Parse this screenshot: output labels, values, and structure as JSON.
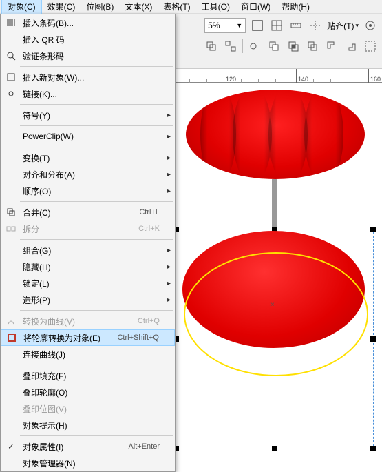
{
  "menubar": {
    "items": [
      {
        "label": "对象(C)"
      },
      {
        "label": "效果(C)"
      },
      {
        "label": "位图(B)"
      },
      {
        "label": "文本(X)"
      },
      {
        "label": "表格(T)"
      },
      {
        "label": "工具(O)"
      },
      {
        "label": "窗口(W)"
      },
      {
        "label": "帮助(H)"
      }
    ]
  },
  "toolbar": {
    "zoom_value": "5%",
    "align_label": "贴齐(T)"
  },
  "ruler": {
    "ticks": [
      "120",
      "140",
      "160"
    ]
  },
  "menu": {
    "insert_barcode": "插入条码(B)...",
    "insert_qr": "插入 QR 码",
    "verify_barcode": "验证条形码",
    "insert_new_obj": "插入新对象(W)...",
    "links": "链接(K)...",
    "symbols": "符号(Y)",
    "powerclip": "PowerClip(W)",
    "transform": "变换(T)",
    "align_dist": "对齐和分布(A)",
    "order": "顺序(O)",
    "combine": "合并(C)",
    "combine_sc": "Ctrl+L",
    "split": "拆分",
    "split_sc": "Ctrl+K",
    "group": "组合(G)",
    "hide": "隐藏(H)",
    "lock": "锁定(L)",
    "shaping": "造形(P)",
    "to_curves": "转换为曲线(V)",
    "to_curves_sc": "Ctrl+Q",
    "outline_to_obj": "将轮廓转换为对象(E)",
    "outline_to_obj_sc": "Ctrl+Shift+Q",
    "connect_curves": "连接曲线(J)",
    "overprint_fill": "叠印填充(F)",
    "overprint_outline": "叠印轮廓(O)",
    "overprint_bitmap": "叠印位图(V)",
    "object_hint": "对象提示(H)",
    "object_props": "对象属性(I)",
    "object_props_sc": "Alt+Enter",
    "object_mgr": "对象管理器(N)"
  }
}
